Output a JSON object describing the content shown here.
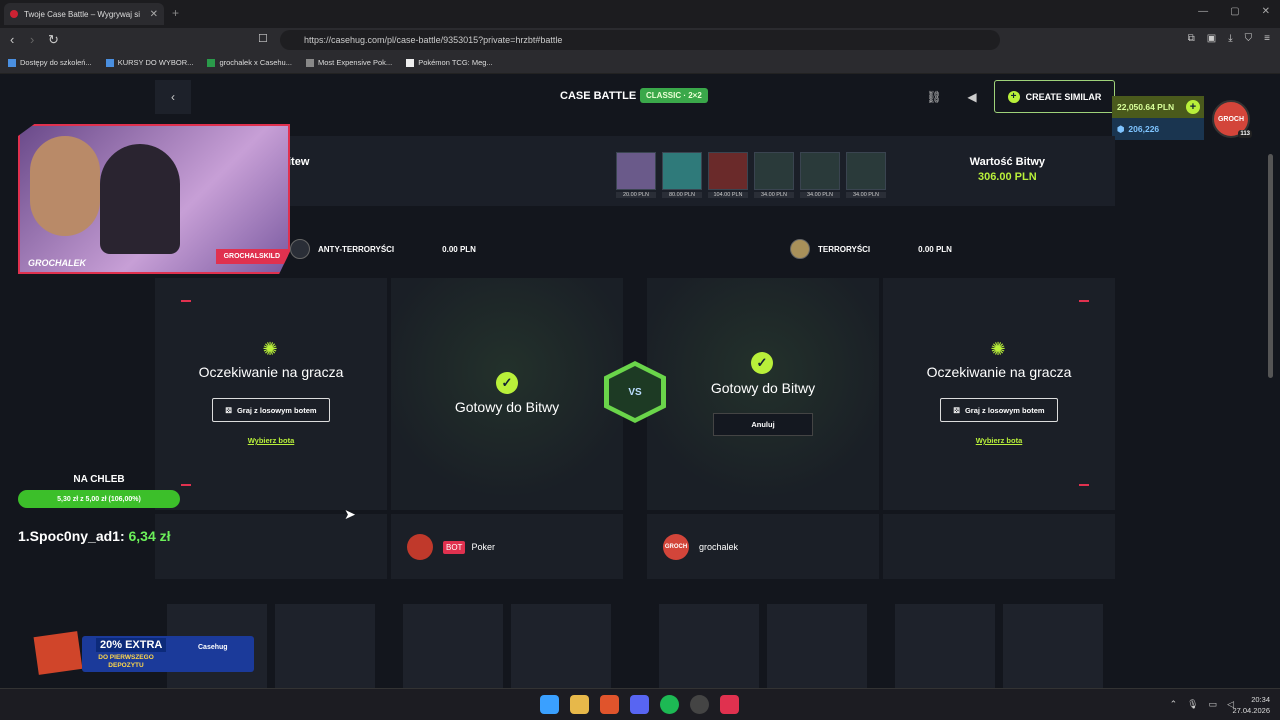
{
  "browser": {
    "tab_title": "Twoje Case Battle – Wygrywaj si",
    "tab_close": "✕",
    "new_tab": "+",
    "url": "https://casehug.com/pl/case-battle/9353015?private=hrzbt#battle",
    "bookmarks": [
      "Dostępy do szkoleń...",
      "KURSY DO WYBOR...",
      "grochalek x Casehu...",
      "Most Expensive Pok...",
      "Pokémon TCG: Meg..."
    ]
  },
  "header": {
    "back": "‹",
    "title": "CASE BATTLE",
    "mode_badge": "CLASSIC · 2×2",
    "create_similar": "CREATE SIMILAR",
    "balance_pln": "22,050.64 PLN",
    "balance_coins": "206,226",
    "avatar_label": "GROCH",
    "level": "113"
  },
  "battle_info": {
    "title_partial": "itew",
    "cases": [
      {
        "price": "20.00 PLN",
        "color": "#6a5a8a"
      },
      {
        "price": "80.00 PLN",
        "color": "#2f7a7a"
      },
      {
        "price": "104.00 PLN",
        "color": "#6a2a2a"
      },
      {
        "price": "34.00 PLN",
        "color": "#2a3a3a"
      },
      {
        "price": "34.00 PLN",
        "color": "#2a3a3a"
      },
      {
        "price": "34.00 PLN",
        "color": "#2a3a3a"
      }
    ],
    "value_label": "Wartość Bitwy",
    "value": "306.00 PLN"
  },
  "teams": {
    "ct_name": "ANTY-TERRORYŚCI",
    "ct_value": "0.00 PLN",
    "t_name": "TERRORYŚCI",
    "t_value": "0.00 PLN"
  },
  "slots": {
    "waiting_text": "Oczekiwanie na gracza",
    "ready_text": "Gotowy do Bitwy",
    "random_bot": "Graj z losowym botem",
    "pick_bot": "Wybierz bota",
    "cancel": "Anuluj",
    "vs": "VS"
  },
  "players": {
    "bot_tag": "BOT",
    "bot_name": "Poker",
    "player_name": "grochalek",
    "player_avatar": "GROCH"
  },
  "overlay": {
    "goal_title": "NA CHLEB",
    "goal_progress": "5,30 zł z 5,00 zł (106,00%)",
    "donor_name": "1.Spoc0ny_ad1:",
    "donor_amount": "6,34 zł",
    "cam_social": "GROCHALSKILD",
    "cam_logo": "GROCHALEK",
    "promo_big": "20% EXTRA",
    "promo_small": "DO PIERWSZEGO DEPOZYTU",
    "promo_brand": "Casehug"
  },
  "taskbar": {
    "time": "20:34",
    "date": "27.04.2026"
  }
}
